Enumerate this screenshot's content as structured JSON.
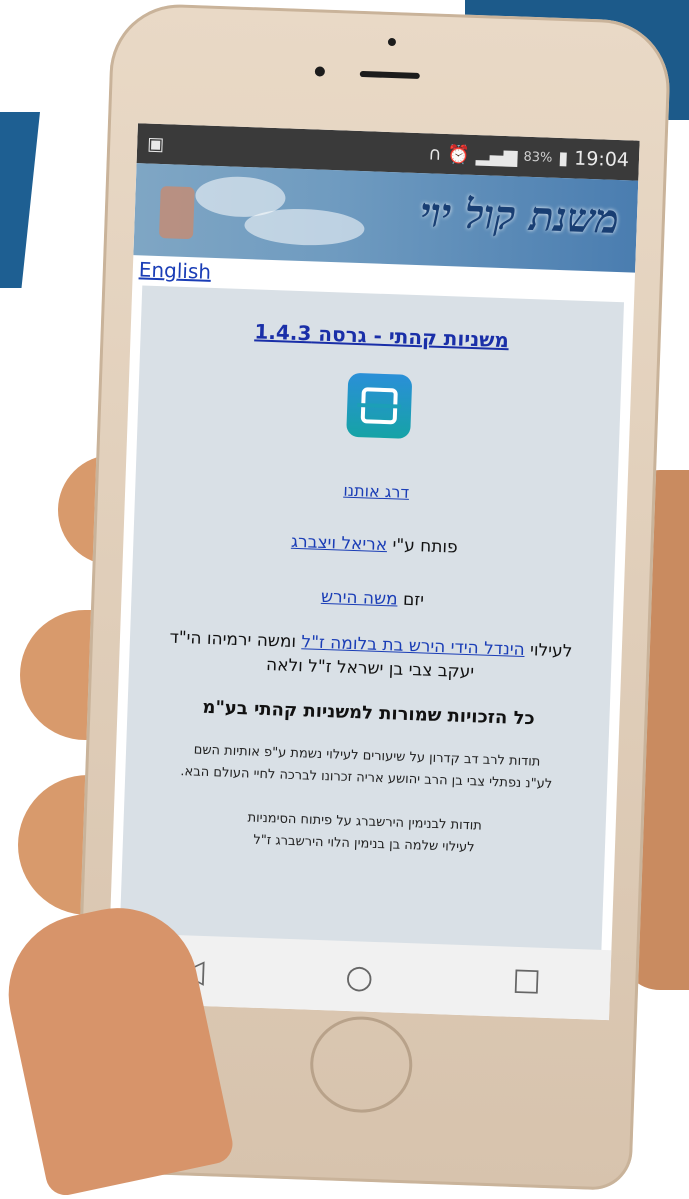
{
  "status_bar": {
    "battery_percent": "83%",
    "time": "19:04"
  },
  "banner": {
    "title": "משנת קול יוי"
  },
  "language_link": "English",
  "about": {
    "version_title": "משניות קהתי - גרסה 1.4.3",
    "rate_link": "דרג אותנו",
    "developer_prefix": "פותח ע\"י",
    "developer_name": "אריאל ויצברג",
    "initiator_prefix": "יזם",
    "initiator_name": "משה הירש",
    "dedication_prefix": "לעילוי",
    "dedication_link": "הינדל הידי הירש בת בלומה ז\"ל",
    "dedication_rest1": "ומשה ירמיהו הי\"ד",
    "dedication_rest2": "יעקב צבי בן ישראל ז\"ל ולאה",
    "rights": "כל הזכויות שמורות למשניות קהתי בע\"מ",
    "thanks_1a": "תודות לרב דב קדרון על שיעורים לעילוי נשמת ע\"פ אותיות השם",
    "thanks_1b": "לע\"נ נפתלי צבי בן הרב יהושע אריה זכרונו לברכה לחיי העולם הבא.",
    "thanks_2a": "תודות לבנימין הירשברג על פיתוח הסימניות",
    "thanks_2b": "לעילוי שלמה בן בנימין הלוי הירשברג ז\"ל"
  },
  "nav": {
    "back": "◁",
    "home": "○",
    "recents": "☐"
  }
}
